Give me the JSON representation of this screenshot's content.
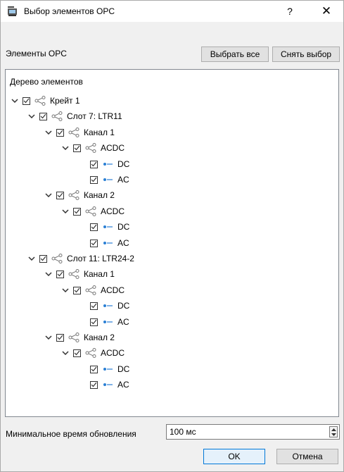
{
  "window": {
    "title": "Выбор элементов OPC",
    "help_label": "?",
    "close_label": "✕"
  },
  "section_label": "Элементы OPC",
  "buttons": {
    "select_all": "Выбрать все",
    "clear_selection": "Снять выбор",
    "ok": "OK",
    "cancel": "Отмена"
  },
  "tree": {
    "header": "Дерево элементов",
    "nodes": [
      {
        "label": "Крейт 1",
        "level": 0,
        "type": "group",
        "expanded": true,
        "checked": true
      },
      {
        "label": "Слот  7: LTR11",
        "level": 1,
        "type": "group",
        "expanded": true,
        "checked": true
      },
      {
        "label": "Канал 1",
        "level": 2,
        "type": "group",
        "expanded": true,
        "checked": true
      },
      {
        "label": "ACDC",
        "level": 3,
        "type": "group",
        "expanded": true,
        "checked": true
      },
      {
        "label": "DC",
        "level": 4,
        "type": "item",
        "checked": true
      },
      {
        "label": "AC",
        "level": 4,
        "type": "item",
        "checked": true
      },
      {
        "label": "Канал 2",
        "level": 2,
        "type": "group",
        "expanded": true,
        "checked": true
      },
      {
        "label": "ACDC",
        "level": 3,
        "type": "group",
        "expanded": true,
        "checked": true
      },
      {
        "label": "DC",
        "level": 4,
        "type": "item",
        "checked": true
      },
      {
        "label": "AC",
        "level": 4,
        "type": "item",
        "checked": true
      },
      {
        "label": "Слот 11: LTR24-2",
        "level": 1,
        "type": "group",
        "expanded": true,
        "checked": true
      },
      {
        "label": "Канал 1",
        "level": 2,
        "type": "group",
        "expanded": true,
        "checked": true
      },
      {
        "label": "ACDC",
        "level": 3,
        "type": "group",
        "expanded": true,
        "checked": true
      },
      {
        "label": "DC",
        "level": 4,
        "type": "item",
        "checked": true
      },
      {
        "label": "AC",
        "level": 4,
        "type": "item",
        "checked": true
      },
      {
        "label": "Канал 2",
        "level": 2,
        "type": "group",
        "expanded": true,
        "checked": true
      },
      {
        "label": "ACDC",
        "level": 3,
        "type": "group",
        "expanded": true,
        "checked": true
      },
      {
        "label": "DC",
        "level": 4,
        "type": "item",
        "checked": true
      },
      {
        "label": "AC",
        "level": 4,
        "type": "item",
        "checked": true
      }
    ]
  },
  "update_interval": {
    "label": "Минимальное время обновления",
    "value": "100 мс"
  },
  "icons": {
    "group": "share-icon",
    "item": "signal-tag-icon",
    "expand": "chevron-down-icon",
    "check": "checkbox-checked-icon"
  },
  "colors": {
    "item_icon": "#2a7fd4",
    "ok_border": "#0078d7"
  }
}
